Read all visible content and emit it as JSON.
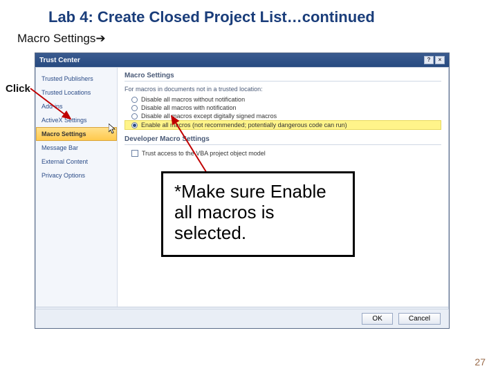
{
  "title": "Lab 4: Create Closed Project List…continued",
  "subtitle_prefix": "Macro Settings",
  "subtitle_arrow": "➔",
  "click_label": "Click",
  "page_number": "27",
  "dialog": {
    "title": "Trust Center",
    "help_btn": "?",
    "close_btn": "×",
    "sidebar": [
      "Trusted Publishers",
      "Trusted Locations",
      "Add-ins",
      "ActiveX Settings",
      "Macro Settings",
      "Message Bar",
      "External Content",
      "Privacy Options"
    ],
    "sidebar_selected_index": 4,
    "section1_header": "Macro Settings",
    "group_caption": "For macros in documents not in a trusted location:",
    "radios": [
      "Disable all macros without notification",
      "Disable all macros with notification",
      "Disable all macros except digitally signed macros",
      "Enable all macros (not recommended; potentially dangerous code can run)"
    ],
    "radio_selected_index": 3,
    "section2_header": "Developer Macro Settings",
    "checkbox_label": "Trust access to the VBA project object model",
    "ok_label": "OK",
    "cancel_label": "Cancel"
  },
  "callout_text": "*Make sure Enable all macros is selected."
}
